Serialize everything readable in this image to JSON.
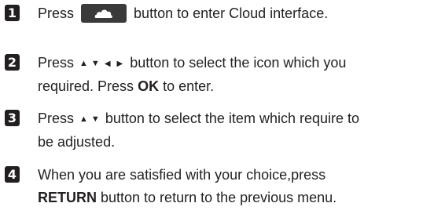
{
  "steps": [
    {
      "number": "1",
      "text_before": "Press",
      "text_after": "button to enter Cloud  interface."
    },
    {
      "number": "2",
      "text_before": "Press",
      "text_after": "button to select the icon which you",
      "line2_before": "required. Press ",
      "line2_bold": "OK",
      "line2_after": " to enter."
    },
    {
      "number": "3",
      "text_before": "Press",
      "text_after": "button to select the item which require to",
      "line2": "be adjusted."
    },
    {
      "number": "4",
      "line1": "When you are satisfied with your choice,press",
      "line2_bold": "RETURN",
      "line2_after": " button to return to the previous menu."
    }
  ],
  "icons": {
    "cloud_button": "cloud-icon",
    "up": "up-arrow-icon",
    "down": "down-arrow-icon",
    "left": "left-arrow-icon",
    "right": "right-arrow-icon"
  },
  "colors": {
    "text": "#231f20",
    "button": "#3a3a3a"
  }
}
